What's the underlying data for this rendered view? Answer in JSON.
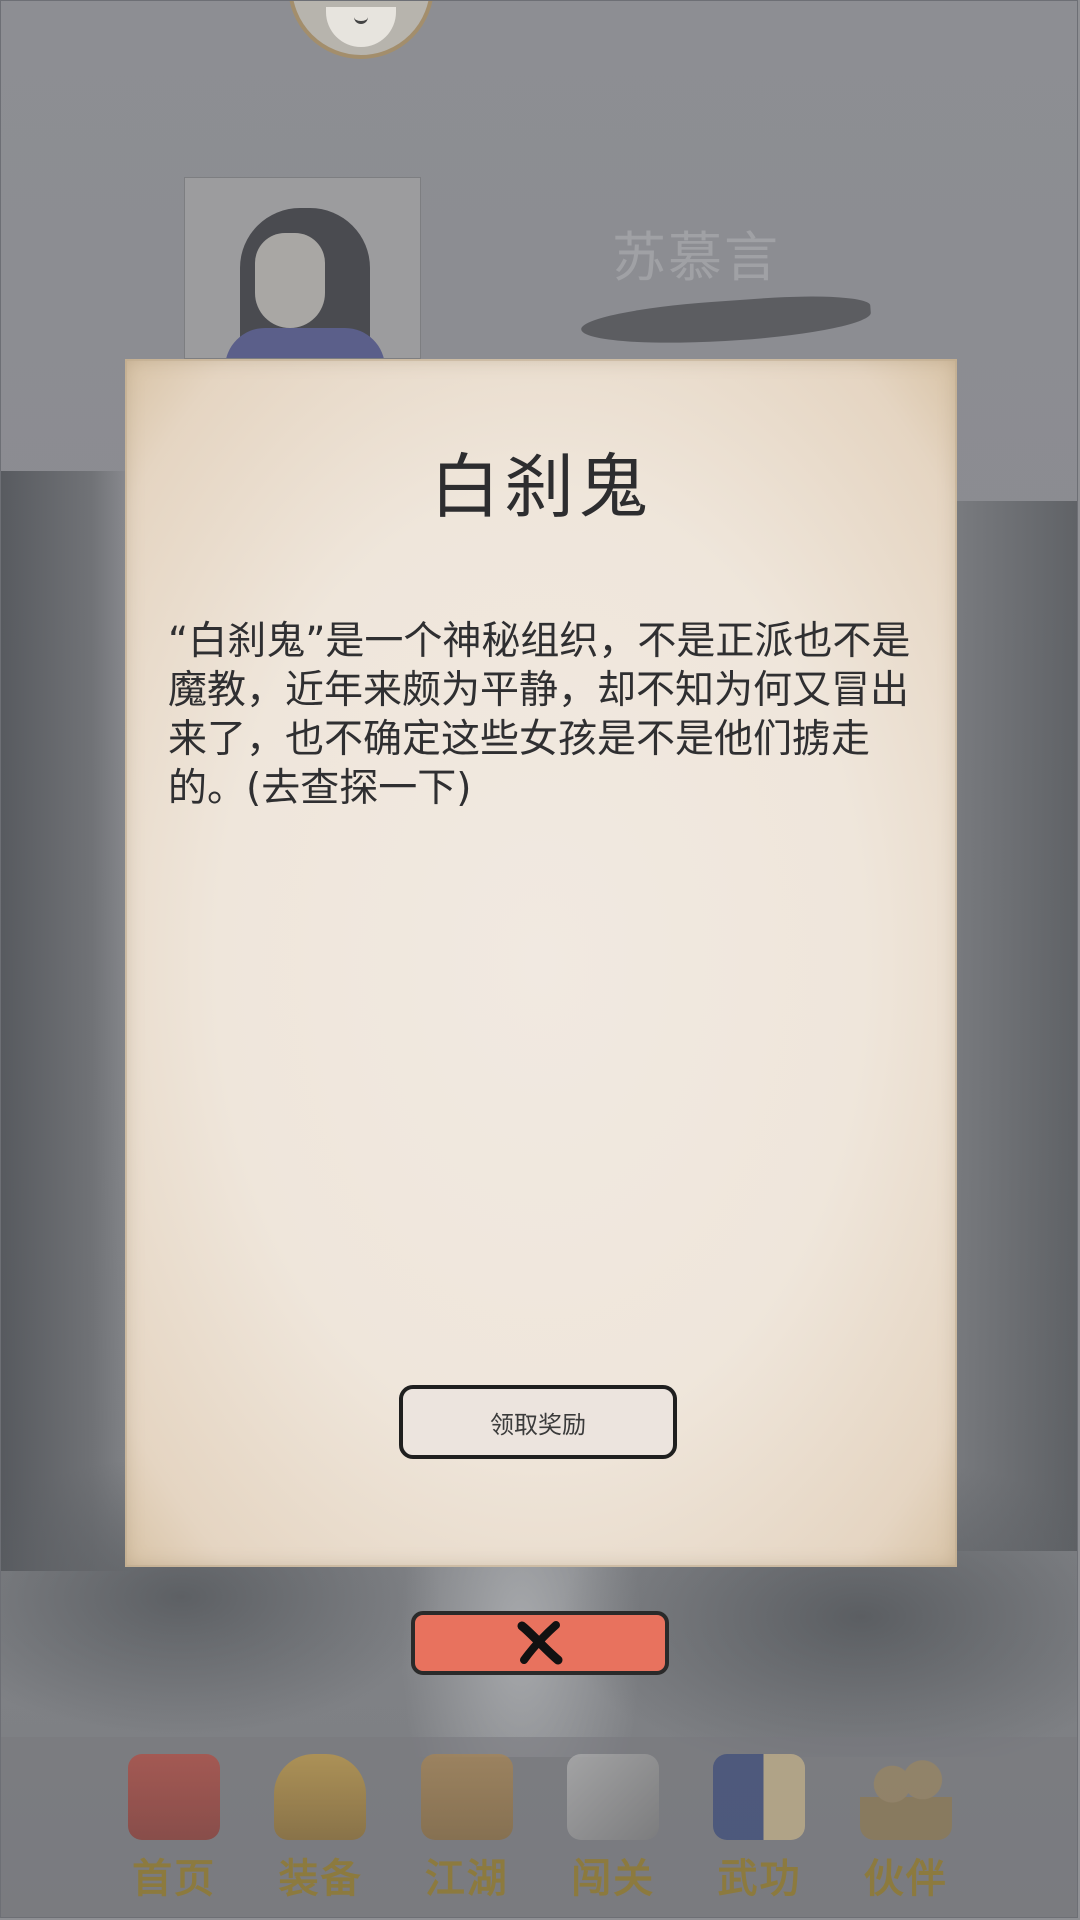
{
  "background": {
    "character_name": "苏慕言"
  },
  "dialog": {
    "title": "白刹鬼",
    "body": "“白刹鬼”是一个神秘组织，不是正派也不是魔教，近年来颇为平静，却不知为何又冒出来了，也不确定这些女孩是不是他们掳走的。(去查探一下)",
    "reward_button_label": "领取奖励"
  },
  "bottom_nav": {
    "items": [
      {
        "label": "首页",
        "icon": "temple-icon",
        "color": "#a3433c"
      },
      {
        "label": "装备",
        "icon": "armor-icon",
        "color": "#b28a3c"
      },
      {
        "label": "江湖",
        "icon": "scroll-map-icon",
        "color": "#9b7a45"
      },
      {
        "label": "闯关",
        "icon": "crossed-swords-icon",
        "color": "#9a9a9a"
      },
      {
        "label": "武功",
        "icon": "martial-book-icon",
        "color": "#3a4a7a"
      },
      {
        "label": "伙伴",
        "icon": "companions-icon",
        "color": "#8e7a52"
      }
    ]
  },
  "colors": {
    "overlay": "#8f9094",
    "close_button": "#e8725e",
    "nav_label": "#8f7a38"
  }
}
